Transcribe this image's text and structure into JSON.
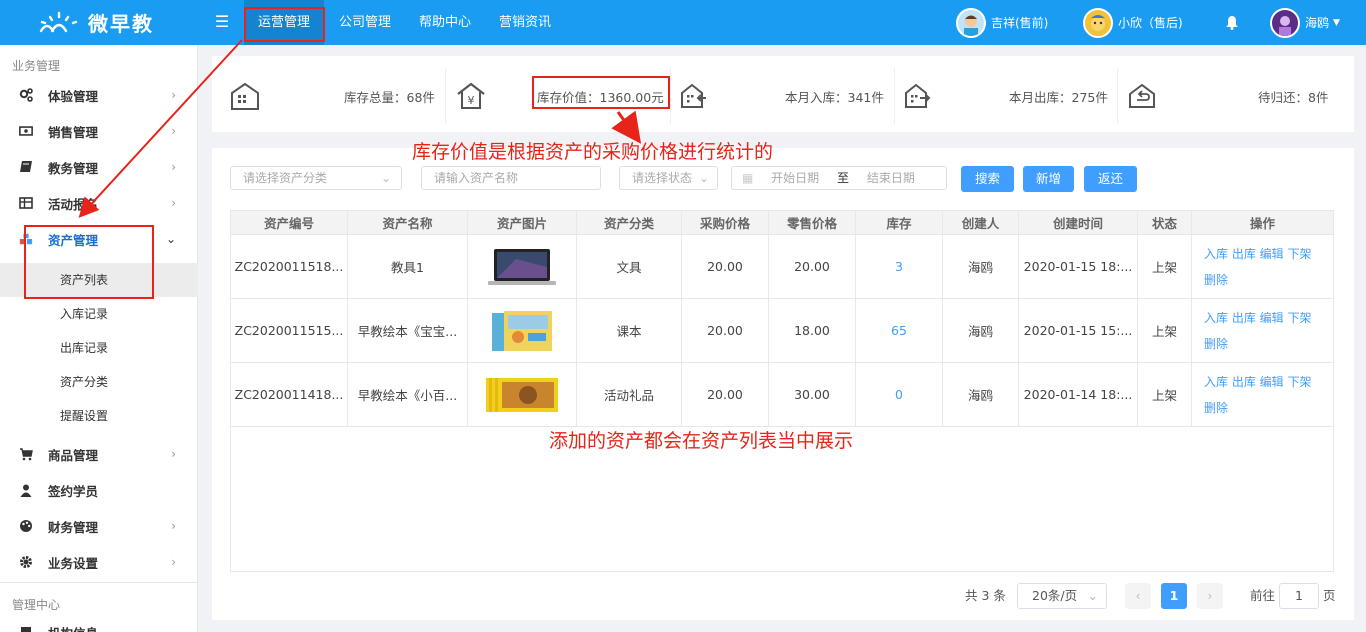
{
  "app": {
    "logo_text": "微早教"
  },
  "topnav": [
    {
      "label": "运营管理",
      "active": true
    },
    {
      "label": "公司管理",
      "active": false
    },
    {
      "label": "帮助中心",
      "active": false
    },
    {
      "label": "营销资讯",
      "active": false
    }
  ],
  "users": [
    {
      "name": "吉祥(售前)"
    },
    {
      "name": "小欣（售后)"
    },
    {
      "name": "海鸥",
      "has_dropdown": true
    }
  ],
  "sidebar": {
    "section1": "业务管理",
    "items": [
      {
        "label": "体验管理",
        "icon": "gears-icon"
      },
      {
        "label": "销售管理",
        "icon": "money-icon"
      },
      {
        "label": "教务管理",
        "icon": "book-icon"
      },
      {
        "label": "活动报名",
        "icon": "table-icon"
      },
      {
        "label": "资产管理",
        "icon": "cubes-icon",
        "expanded": true
      }
    ],
    "subitems": [
      "资产列表",
      "入库记录",
      "出库记录",
      "资产分类",
      "提醒设置"
    ],
    "items2": [
      {
        "label": "商品管理",
        "icon": "cart-icon"
      },
      {
        "label": "签约学员",
        "icon": "user-icon"
      },
      {
        "label": "财务管理",
        "icon": "palette-icon"
      },
      {
        "label": "业务设置",
        "icon": "settings-icon"
      }
    ],
    "section2": "管理中心",
    "partial_item": "机构信息"
  },
  "stats": [
    {
      "label": "库存总量：68件",
      "icon": "warehouse-icon"
    },
    {
      "label": "库存价值：1360.00元",
      "icon": "yen-house-icon"
    },
    {
      "label": "本月入库：341件",
      "icon": "inbound-icon"
    },
    {
      "label": "本月出库：275件",
      "icon": "outbound-icon"
    },
    {
      "label": "待归还：8件",
      "icon": "return-icon"
    }
  ],
  "filters": {
    "category_placeholder": "请选择资产分类",
    "name_placeholder": "请输入资产名称",
    "status_placeholder": "请选择状态",
    "start_date": "开始日期",
    "to": "至",
    "end_date": "结束日期",
    "search": "搜索",
    "add": "新增",
    "back": "返还"
  },
  "table": {
    "headers": [
      "资产编号",
      "资产名称",
      "资产图片",
      "资产分类",
      "采购价格",
      "零售价格",
      "库存",
      "创建人",
      "创建时间",
      "状态",
      "操作"
    ],
    "rows": [
      {
        "id": "ZC2020011518...",
        "name": "教具1",
        "image": "laptop",
        "category": "文具",
        "purchase": "20.00",
        "retail": "20.00",
        "stock": "3",
        "creator": "海鸥",
        "time": "2020-01-15 18:...",
        "status": "上架",
        "ops1": "入库 出库 编辑 下架",
        "ops2": "删除"
      },
      {
        "id": "ZC2020011515...",
        "name": "早教绘本《宝宝...",
        "image": "book-box",
        "category": "课本",
        "purchase": "20.00",
        "retail": "18.00",
        "stock": "65",
        "creator": "海鸥",
        "time": "2020-01-15 15:...",
        "status": "上架",
        "ops1": "入库 出库 编辑 下架",
        "ops2": "删除"
      },
      {
        "id": "ZC2020011418...",
        "name": "早教绘本《小百...",
        "image": "book-set",
        "category": "活动礼品",
        "purchase": "20.00",
        "retail": "30.00",
        "stock": "0",
        "creator": "海鸥",
        "time": "2020-01-14 18:...",
        "status": "上架",
        "ops1": "入库 出库 编辑 下架",
        "ops2": "删除"
      }
    ]
  },
  "pagination": {
    "total": "共 3 条",
    "page_size": "20条/页",
    "current": "1",
    "goto_label": "前往",
    "goto_value": "1",
    "page_unit": "页"
  },
  "annotations": {
    "note1": "库存价值是根据资产的采购价格进行统计的",
    "note2": "添加的资产都会在资产列表当中展示"
  },
  "colors": {
    "primary": "#1a9cf2",
    "button": "#409eff",
    "annotation": "#e8231a"
  }
}
